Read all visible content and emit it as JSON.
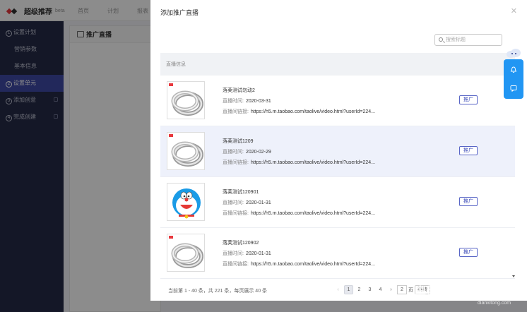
{
  "app": {
    "logo_text": "超级推荐",
    "logo_beta": "beta",
    "nav": [
      "首页",
      "计划",
      "报表"
    ]
  },
  "sidebar": {
    "items": [
      {
        "num": "1",
        "label": "设置计划",
        "type": "step"
      },
      {
        "label": "营销参数",
        "type": "sub"
      },
      {
        "label": "基本信息",
        "type": "sub"
      },
      {
        "num": "2",
        "label": "设置单元",
        "type": "step",
        "active": true
      },
      {
        "num": "3",
        "label": "添加创意",
        "type": "step",
        "locked": true
      },
      {
        "num": "4",
        "label": "完成创建",
        "type": "step",
        "locked": true
      }
    ]
  },
  "panel": {
    "title": "推广直播"
  },
  "dialog": {
    "title": "添加推广直播",
    "close_icon": "close-icon",
    "search_placeholder": "搜索标题",
    "column_header": "直播信息",
    "time_label": "直播时间:",
    "link_label": "直播间链接:",
    "promote_label": "推广",
    "rows": [
      {
        "name": "落荚测试勿动2",
        "time": "2020-03-31",
        "link": "https://h5.m.taobao.com/taolive/video.html?userId=224...",
        "thumb": "ring",
        "highlighted": false
      },
      {
        "name": "落荚测试1209",
        "time": "2020-02-29",
        "link": "https://h5.m.taobao.com/taolive/video.html?userId=224...",
        "thumb": "ring",
        "highlighted": true
      },
      {
        "name": "落荚测试120901",
        "time": "2020-01-31",
        "link": "https://h5.m.taobao.com/taolive/video.html?userId=224...",
        "thumb": "doraemon",
        "highlighted": false
      },
      {
        "name": "落荚测试120902",
        "time": "2020-01-31",
        "link": "https://h5.m.taobao.com/taolive/video.html?userId=224...",
        "thumb": "ring",
        "highlighted": false
      }
    ],
    "footer": {
      "summary": "当前第 1 - 40 条，共 221 条，每页展示 40 条",
      "pages": [
        "1",
        "2",
        "3",
        "4"
      ],
      "current_page": "1",
      "jump_value": "2",
      "jump_suffix": "页",
      "jump_button": "跳转"
    }
  },
  "watermark": {
    "text": "电脑系统网",
    "url": "dianxitong.com"
  },
  "colors": {
    "accent": "#3f4aa6",
    "brand_red": "#e8383d",
    "float_blue": "#2196f3"
  }
}
